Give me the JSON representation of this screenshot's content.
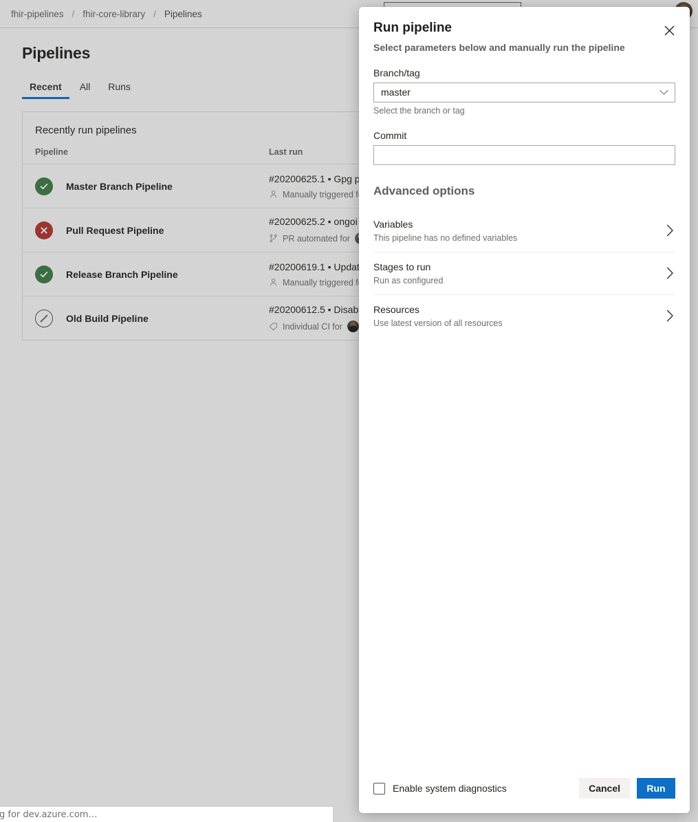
{
  "breadcrumb": {
    "items": [
      "fhir-pipelines",
      "fhir-core-library",
      "Pipelines"
    ],
    "separator": "/"
  },
  "page": {
    "title": "Pipelines",
    "tabs": [
      {
        "label": "Recent",
        "active": true
      },
      {
        "label": "All",
        "active": false
      },
      {
        "label": "Runs",
        "active": false
      }
    ],
    "card": {
      "title": "Recently run pipelines",
      "columns": [
        "Pipeline",
        "Last run"
      ],
      "rows": [
        {
          "status": "succeeded",
          "status_icon": "check-circle-icon",
          "name": "Master Branch Pipeline",
          "last_run": "#20200625.1 • Gpg p",
          "trigger_icon": "person-icon",
          "trigger_text": "Manually triggered fo",
          "avatar": null
        },
        {
          "status": "failed",
          "status_icon": "x-circle-icon",
          "name": "Pull Request Pipeline",
          "last_run": "#20200625.2 • ongoi",
          "trigger_icon": "branch-icon",
          "trigger_text": "PR automated for",
          "avatar": "a1"
        },
        {
          "status": "succeeded",
          "status_icon": "check-circle-icon",
          "name": "Release Branch Pipeline",
          "last_run": "#20200619.1 • Updat",
          "trigger_icon": "person-icon",
          "trigger_text": "Manually triggered fo",
          "avatar": null
        },
        {
          "status": "disabled",
          "status_icon": "no-entry-circle-icon",
          "name": "Old Build Pipeline",
          "last_run": "#20200612.5 • Disab",
          "trigger_icon": "tag-icon",
          "trigger_text": "Individual CI for",
          "avatar": "a2"
        }
      ]
    }
  },
  "dialog": {
    "title": "Run pipeline",
    "subtitle": "Select parameters below and manually run the pipeline",
    "close_icon": "close-icon",
    "branch": {
      "label": "Branch/tag",
      "value": "master",
      "description": "Select the branch or tag",
      "chevron_icon": "chevron-down-icon"
    },
    "commit": {
      "label": "Commit",
      "value": "",
      "placeholder": ""
    },
    "advanced_title": "Advanced options",
    "options": [
      {
        "title": "Variables",
        "description": "This pipeline has no defined variables",
        "chevron_icon": "chevron-right-icon"
      },
      {
        "title": "Stages to run",
        "description": "Run as configured",
        "chevron_icon": "chevron-right-icon"
      },
      {
        "title": "Resources",
        "description": "Use latest version of all resources",
        "chevron_icon": "chevron-right-icon"
      }
    ],
    "diagnostics_label": "Enable system diagnostics",
    "diagnostics_checked": false,
    "cancel_label": "Cancel",
    "run_label": "Run"
  },
  "status_bar": {
    "text": "g for dev.azure.com…"
  },
  "colors": {
    "accent": "#0c70c4",
    "success": "#3d7d43",
    "error": "#b8332e",
    "disabled": "#57534f",
    "text_primary": "#1f1e1d",
    "text_secondary": "#6f6d6b"
  }
}
